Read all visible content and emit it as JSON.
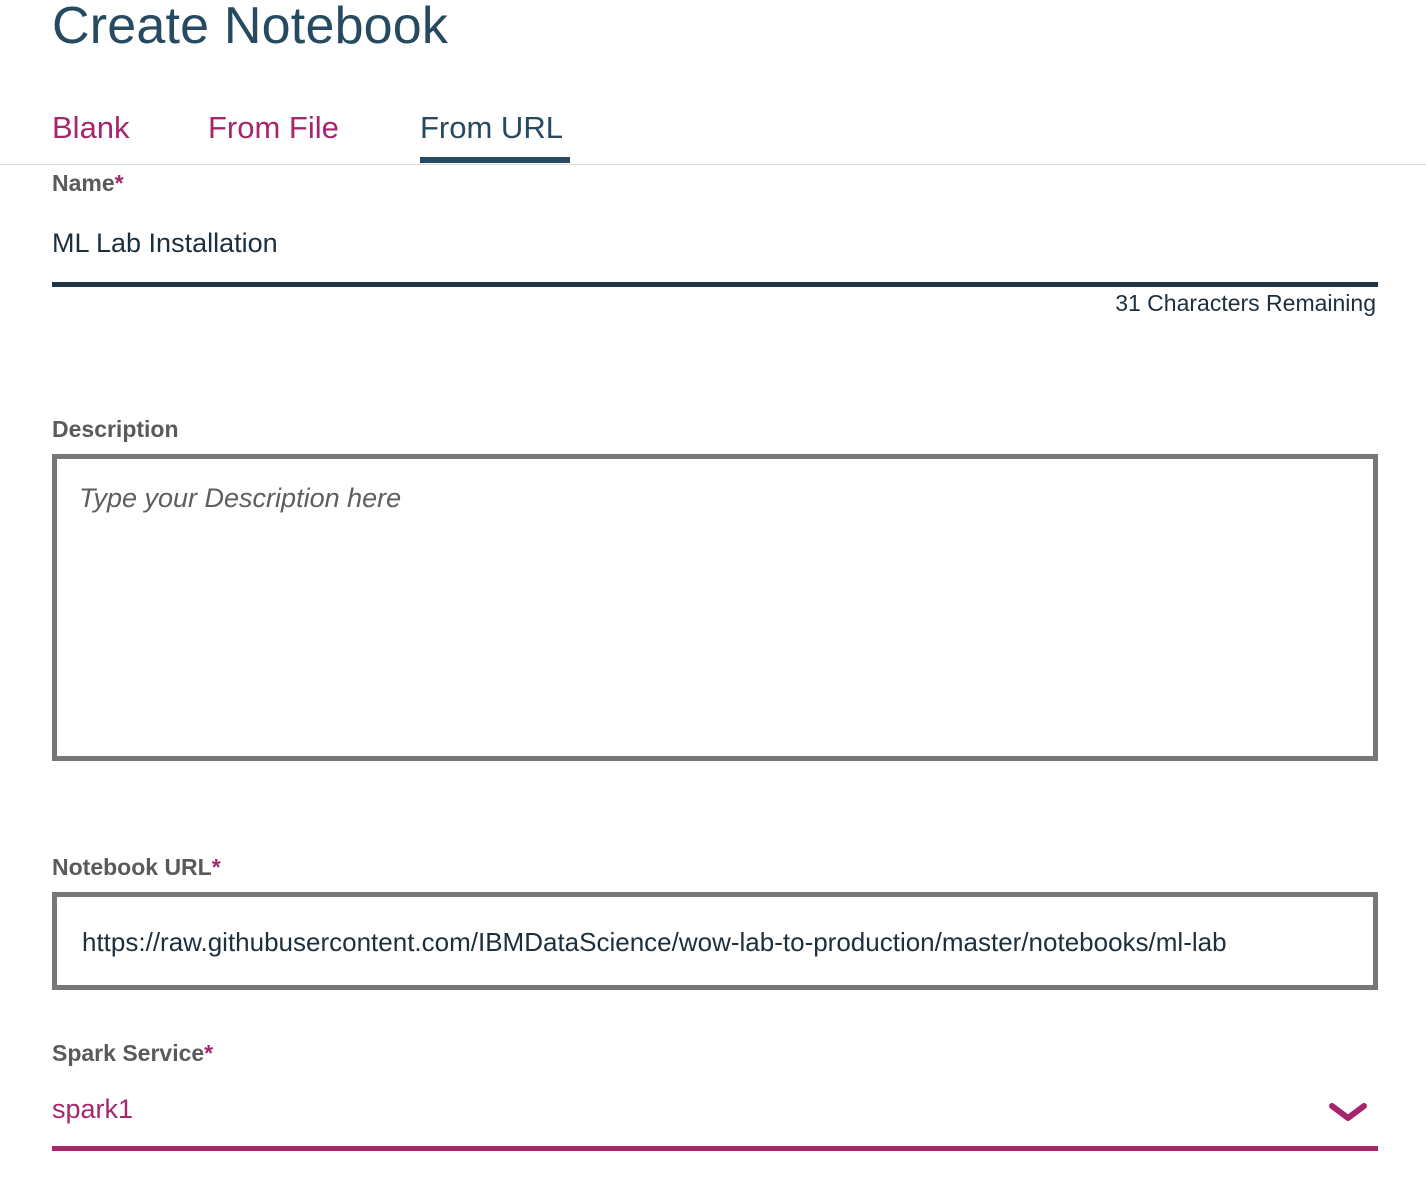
{
  "page": {
    "title": "Create Notebook"
  },
  "tabs": [
    {
      "label": "Blank",
      "active": false
    },
    {
      "label": "From File",
      "active": false
    },
    {
      "label": "From URL",
      "active": true
    }
  ],
  "form": {
    "name": {
      "label": "Name",
      "required_mark": "*",
      "value": "ML Lab Installation",
      "counter": "31 Characters Remaining"
    },
    "description": {
      "label": "Description",
      "placeholder": "Type your Description here",
      "value": ""
    },
    "notebook_url": {
      "label": "Notebook URL",
      "required_mark": "*",
      "value": "https://raw.githubusercontent.com/IBMDataScience/wow-lab-to-production/master/notebooks/ml-lab"
    },
    "spark_service": {
      "label": "Spark Service",
      "required_mark": "*",
      "selected": "spark1",
      "icon": "chevron-down-icon"
    }
  },
  "colors": {
    "primary_text": "#264a60",
    "accent": "#a6266e",
    "border": "#777777",
    "label": "#5a5a5a"
  }
}
